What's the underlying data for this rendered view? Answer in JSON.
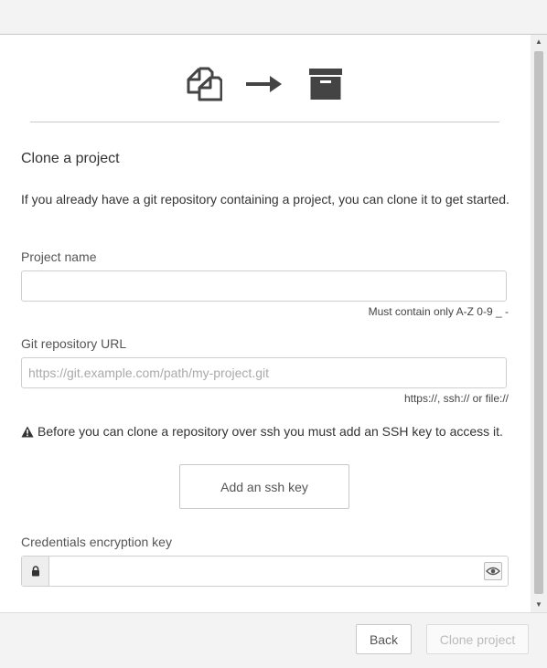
{
  "window": {
    "scrollbar": {
      "up_arrow": "▲",
      "down_arrow": "▼"
    }
  },
  "hero": {
    "icons": [
      "copy-icon",
      "arrow-right-icon",
      "archive-icon"
    ]
  },
  "form": {
    "title": "Clone a project",
    "intro": "If you already have a git repository containing a project, you can clone it to get started.",
    "project_name": {
      "label": "Project name",
      "value": "",
      "placeholder": "",
      "hint": "Must contain only A-Z 0-9 _ -"
    },
    "git_url": {
      "label": "Git repository URL",
      "value": "",
      "placeholder": "https://git.example.com/path/my-project.git",
      "hint": "https://, ssh:// or file://"
    },
    "ssh_warning": "Before you can clone a repository over ssh you must add an SSH key to access it.",
    "add_ssh_key_label": "Add an ssh key",
    "credentials": {
      "label": "Credentials encryption key",
      "value": "",
      "placeholder": ""
    }
  },
  "footer": {
    "back_label": "Back",
    "clone_label": "Clone project",
    "clone_enabled": false
  },
  "colors": {
    "icon": "#444444",
    "border": "#cfcfcf",
    "disabled_text": "#bbbbbb"
  }
}
